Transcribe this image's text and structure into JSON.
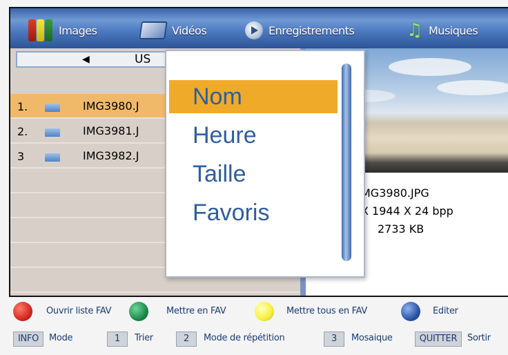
{
  "tabs": {
    "images": "Images",
    "videos": "Vidéos",
    "recordings": "Enregistrements",
    "music": "Musiques"
  },
  "path": {
    "label": "US"
  },
  "files": [
    {
      "num": "1.",
      "name": "IMG3980.J"
    },
    {
      "num": "2.",
      "name": "IMG3981.J"
    },
    {
      "num": "3",
      "name": "IMG3982.J"
    }
  ],
  "sort_menu": {
    "options": [
      "Nom",
      "Heure",
      "Taille",
      "Favoris"
    ],
    "selected": "Nom"
  },
  "preview": {
    "filename": "MG3980.JPG",
    "dimensions": "X 1944 X 24 bpp",
    "size": "2733 KB"
  },
  "color_buttons": [
    {
      "color": "#d42a1f",
      "label": "Ouvrir liste FAV"
    },
    {
      "color": "#1e8a4b",
      "label": "Mettre en FAV"
    },
    {
      "color": "#f7ef3a",
      "label": "Mettre tous en FAV"
    },
    {
      "color": "#2a56a8",
      "label": "Editer"
    }
  ],
  "keys": [
    {
      "key": "INFO",
      "label": "Mode"
    },
    {
      "key": "1",
      "label": "Trier"
    },
    {
      "key": "2",
      "label": "Mode de répétition"
    },
    {
      "key": "3",
      "label": "Mosaique"
    },
    {
      "key": "QUITTER",
      "label": "Sortir"
    }
  ],
  "icons": [
    "images-icon",
    "video-icon",
    "recordings-icon",
    "music-icon",
    "folder-icon",
    "back-arrow-icon"
  ]
}
